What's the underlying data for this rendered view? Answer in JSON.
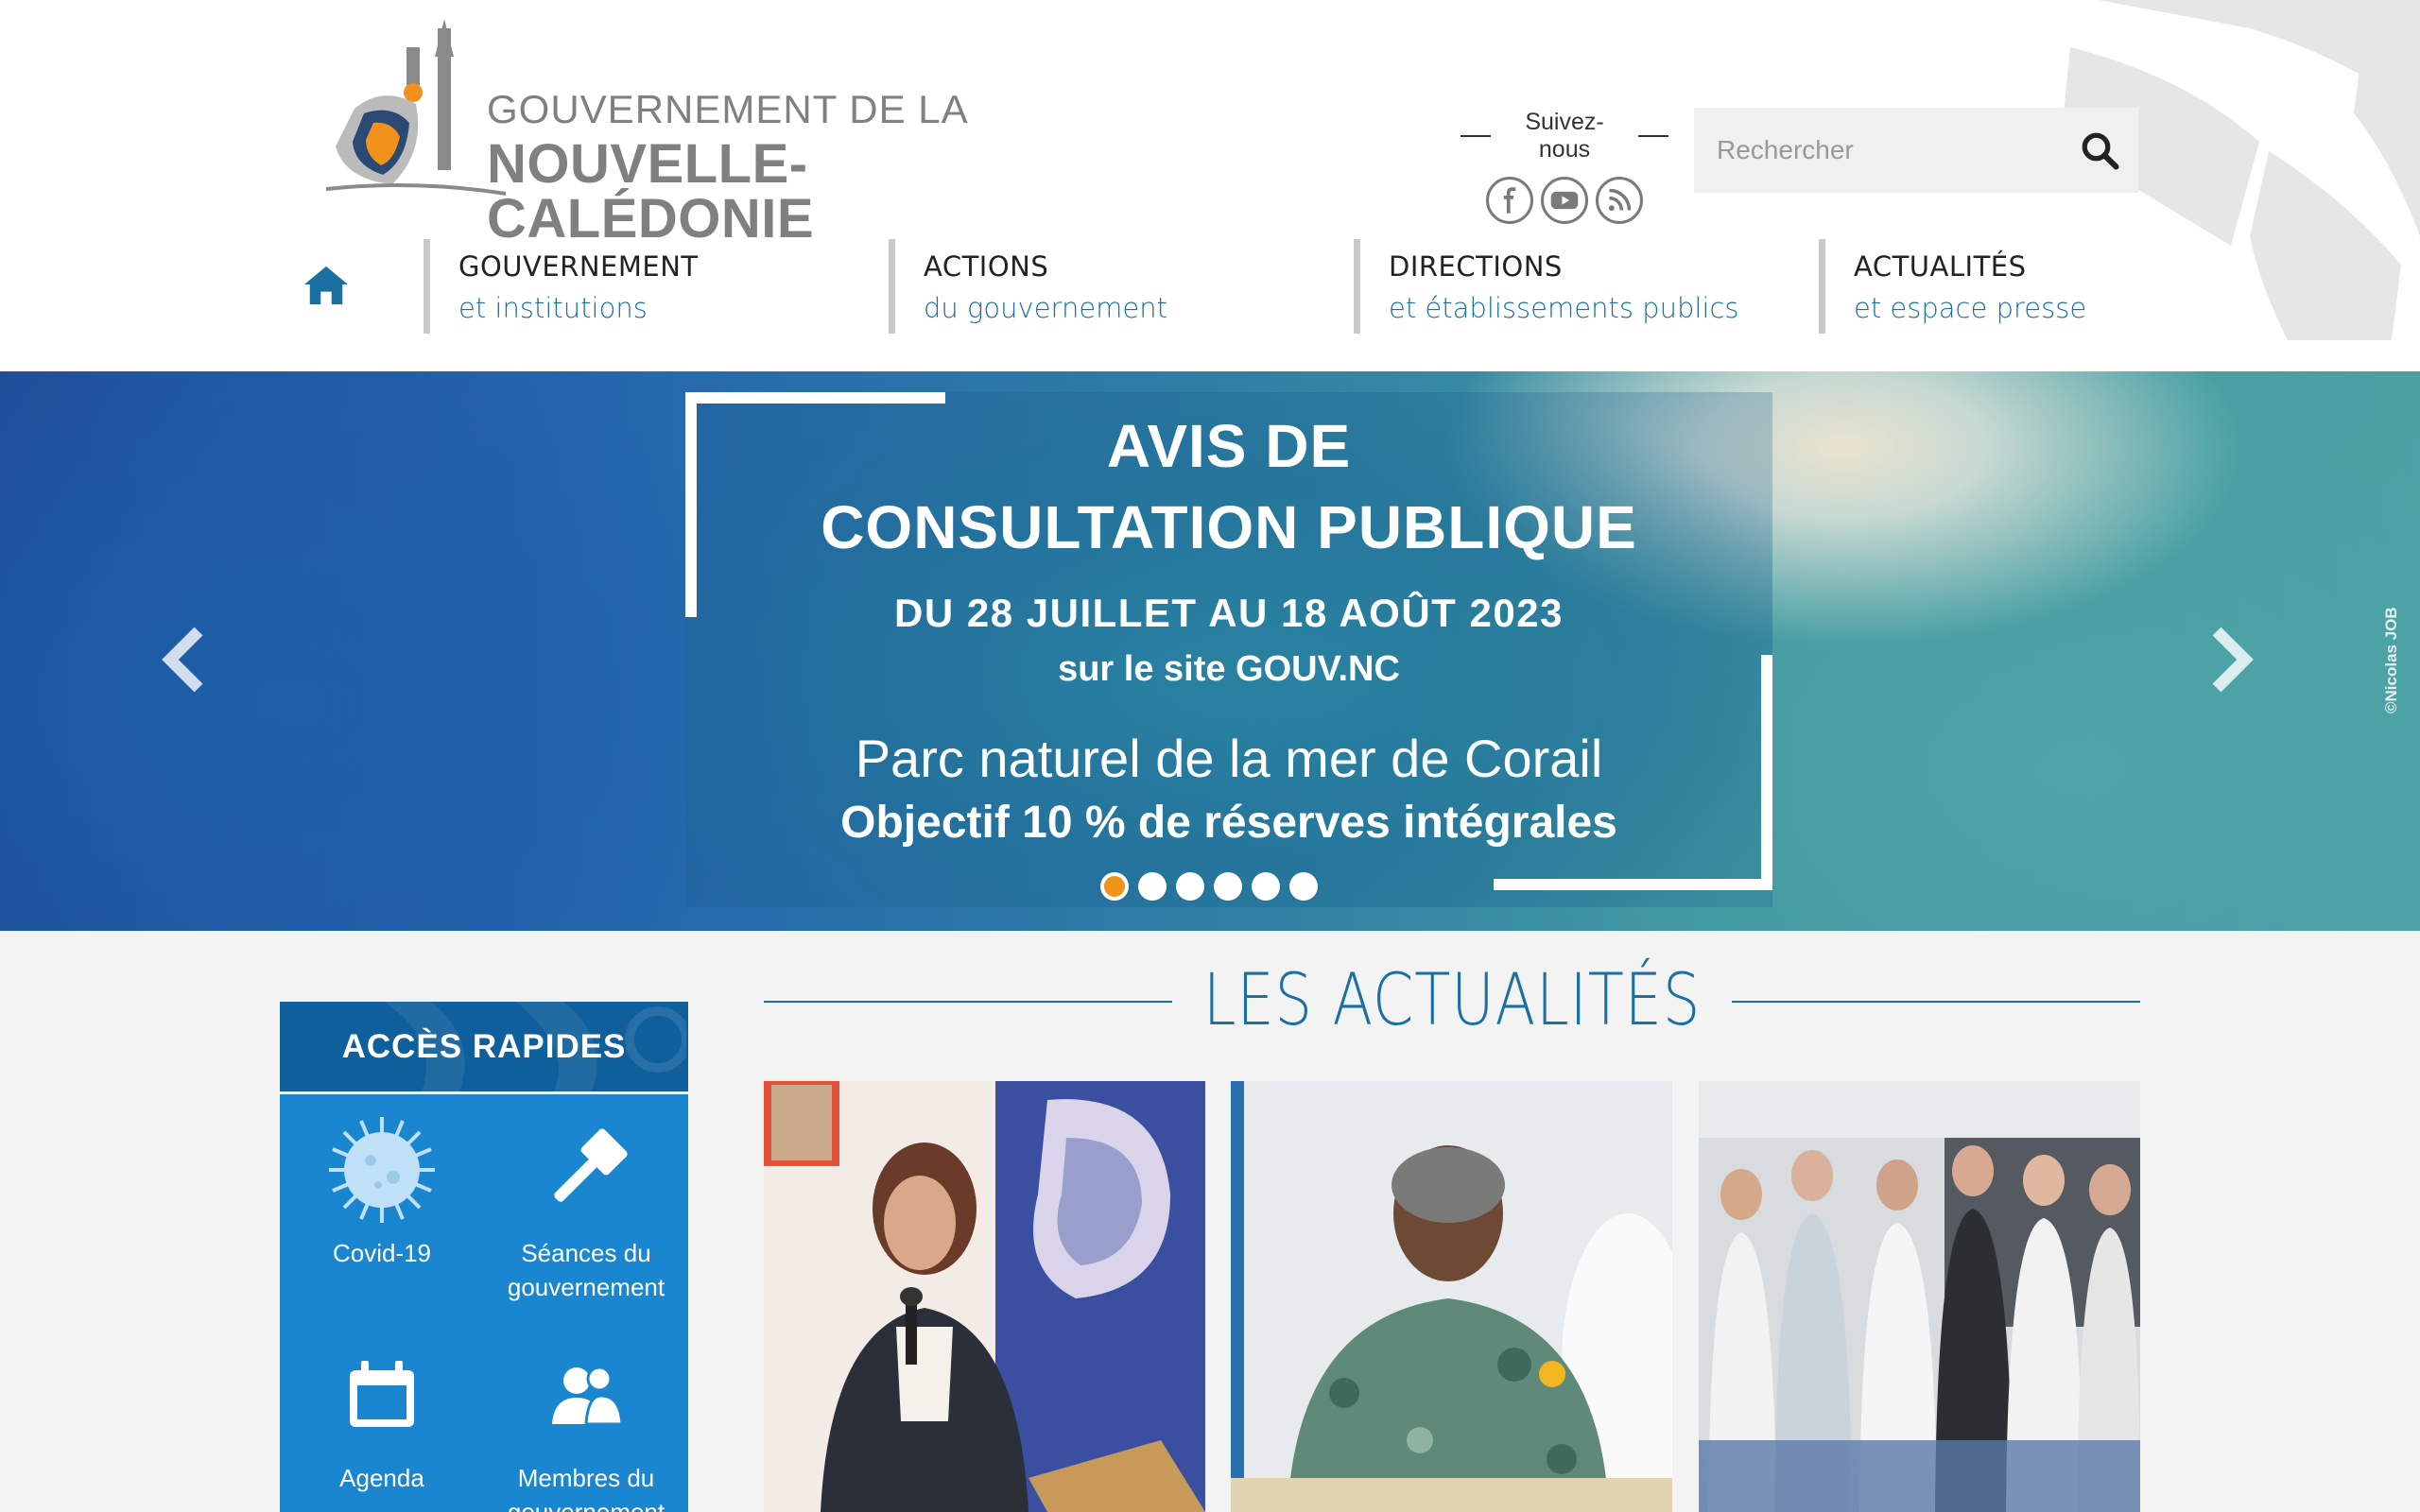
{
  "header": {
    "logo_line1": "GOUVERNEMENT DE LA",
    "logo_line2": "NOUVELLE-CALÉDONIE",
    "follow_label": "Suivez-nous",
    "social": [
      {
        "icon": "facebook-icon"
      },
      {
        "icon": "youtube-icon"
      },
      {
        "icon": "rss-icon"
      }
    ],
    "search": {
      "placeholder": "Rechercher",
      "icon": "search-icon"
    }
  },
  "nav": {
    "home_icon": "home-icon",
    "items": [
      {
        "title": "GOUVERNEMENT",
        "subtitle": "et institutions"
      },
      {
        "title": "ACTIONS",
        "subtitle": "du gouvernement"
      },
      {
        "title": "DIRECTIONS",
        "subtitle": "et établissements publics"
      },
      {
        "title": "ACTUALITÉS",
        "subtitle": "et espace presse"
      }
    ]
  },
  "slider": {
    "title_line1": "AVIS DE",
    "title_line2": "CONSULTATION PUBLIQUE",
    "dates": "DU 28 JUILLET AU 18 AOÛT 2023",
    "site": "sur le site GOUV.NC",
    "line1": "Parc naturel de la mer de Corail",
    "line2": "Objectif 10 % de réserves intégrales",
    "credit": "©Nicolas JOB",
    "slide_count": 6,
    "active_slide": 1
  },
  "quick_access": {
    "title": "ACCÈS RAPIDES",
    "items": [
      {
        "label": "Covid-19",
        "icon": "virus-icon"
      },
      {
        "label": "Séances du gouvernement",
        "icon": "gavel-icon"
      },
      {
        "label": "Agenda",
        "icon": "calendar-icon"
      },
      {
        "label": "Membres du gouvernement",
        "icon": "members-icon"
      }
    ]
  },
  "news": {
    "title": "LES ACTUALITÉS",
    "cards": [
      {
        "image": "woman-speaking-at-microphone"
      },
      {
        "image": "man-in-floral-shirt"
      },
      {
        "image": "group-of-men-standing"
      }
    ]
  },
  "colors": {
    "brand_blue": "#1a6fa3",
    "quick_bg": "#1a86cf",
    "quick_head": "#0f5f9c",
    "accent_orange": "#f0921c",
    "logo_grey": "#808080"
  }
}
